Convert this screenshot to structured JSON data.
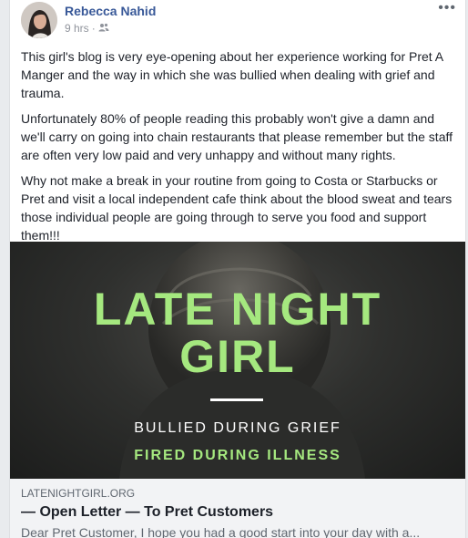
{
  "post": {
    "author": "Rebecca Nahid",
    "time": "9 hrs",
    "separator": "·",
    "privacy_icon": "friends-icon",
    "more_label": "•••",
    "paragraphs": [
      "This girl's blog is very eye-opening about her experience working for Pret A Manger and the way in which she was bullied when dealing with grief and trauma.",
      "Unfortunately 80% of people reading this probably won't give a damn and we'll carry on going into chain restaurants that please remember but the staff are often very low paid and very unhappy and without many rights.",
      "Why not make a break in your routine from going to Costa or Starbucks or Pret and visit a local independent cafe think about the blood sweat and tears those individual people are going through to serve you food and support them!!!"
    ]
  },
  "link_card": {
    "image": {
      "title_line1": "LATE NIGHT",
      "title_line2": "GIRL",
      "subtitle1": "BULLIED DURING GRIEF",
      "subtitle2": "FIRED DURING ILLNESS"
    },
    "domain": "LATENIGHTGIRL.ORG",
    "title": "— Open Letter — To Pret Customers",
    "description": "Dear Pret Customer, I hope you had a good start into your day with a..."
  },
  "colors": {
    "author_link": "#385898",
    "accent_green": "#a5e87f",
    "text": "#1d2129",
    "meta": "#90949c"
  }
}
